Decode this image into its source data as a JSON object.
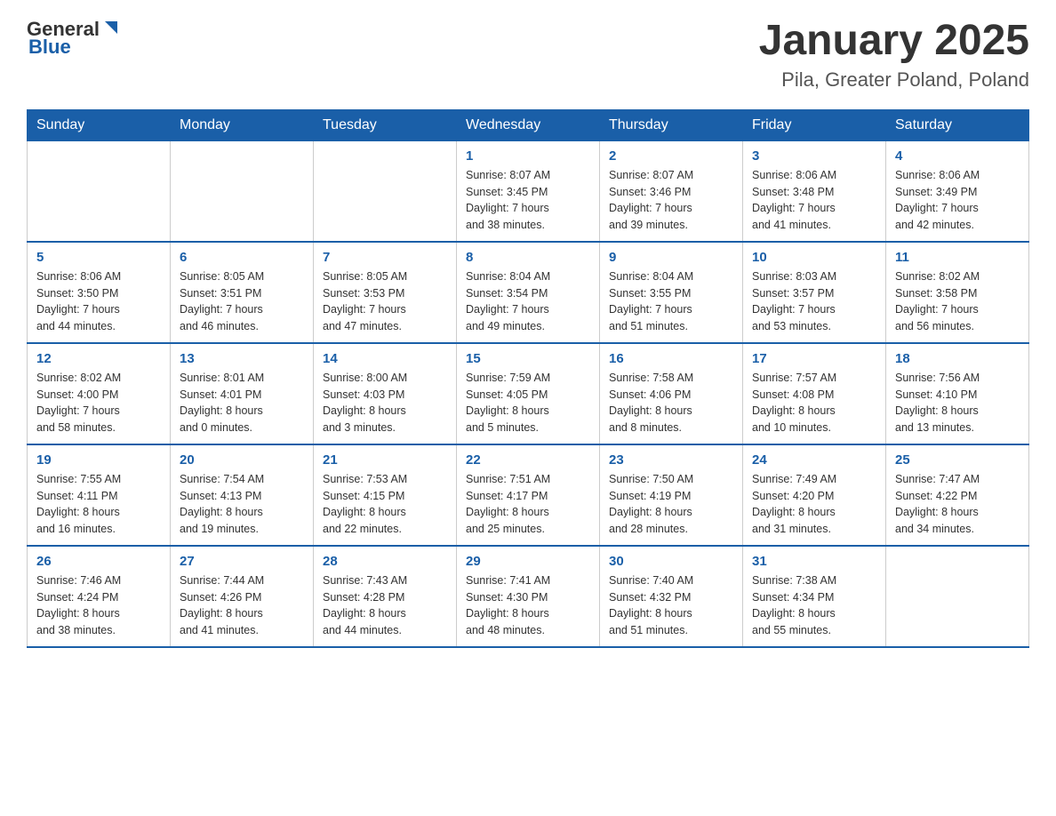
{
  "header": {
    "logo_general": "General",
    "logo_blue": "Blue",
    "title": "January 2025",
    "subtitle": "Pila, Greater Poland, Poland"
  },
  "weekdays": [
    "Sunday",
    "Monday",
    "Tuesday",
    "Wednesday",
    "Thursday",
    "Friday",
    "Saturday"
  ],
  "weeks": [
    [
      {
        "day": "",
        "info": ""
      },
      {
        "day": "",
        "info": ""
      },
      {
        "day": "",
        "info": ""
      },
      {
        "day": "1",
        "info": "Sunrise: 8:07 AM\nSunset: 3:45 PM\nDaylight: 7 hours\nand 38 minutes."
      },
      {
        "day": "2",
        "info": "Sunrise: 8:07 AM\nSunset: 3:46 PM\nDaylight: 7 hours\nand 39 minutes."
      },
      {
        "day": "3",
        "info": "Sunrise: 8:06 AM\nSunset: 3:48 PM\nDaylight: 7 hours\nand 41 minutes."
      },
      {
        "day": "4",
        "info": "Sunrise: 8:06 AM\nSunset: 3:49 PM\nDaylight: 7 hours\nand 42 minutes."
      }
    ],
    [
      {
        "day": "5",
        "info": "Sunrise: 8:06 AM\nSunset: 3:50 PM\nDaylight: 7 hours\nand 44 minutes."
      },
      {
        "day": "6",
        "info": "Sunrise: 8:05 AM\nSunset: 3:51 PM\nDaylight: 7 hours\nand 46 minutes."
      },
      {
        "day": "7",
        "info": "Sunrise: 8:05 AM\nSunset: 3:53 PM\nDaylight: 7 hours\nand 47 minutes."
      },
      {
        "day": "8",
        "info": "Sunrise: 8:04 AM\nSunset: 3:54 PM\nDaylight: 7 hours\nand 49 minutes."
      },
      {
        "day": "9",
        "info": "Sunrise: 8:04 AM\nSunset: 3:55 PM\nDaylight: 7 hours\nand 51 minutes."
      },
      {
        "day": "10",
        "info": "Sunrise: 8:03 AM\nSunset: 3:57 PM\nDaylight: 7 hours\nand 53 minutes."
      },
      {
        "day": "11",
        "info": "Sunrise: 8:02 AM\nSunset: 3:58 PM\nDaylight: 7 hours\nand 56 minutes."
      }
    ],
    [
      {
        "day": "12",
        "info": "Sunrise: 8:02 AM\nSunset: 4:00 PM\nDaylight: 7 hours\nand 58 minutes."
      },
      {
        "day": "13",
        "info": "Sunrise: 8:01 AM\nSunset: 4:01 PM\nDaylight: 8 hours\nand 0 minutes."
      },
      {
        "day": "14",
        "info": "Sunrise: 8:00 AM\nSunset: 4:03 PM\nDaylight: 8 hours\nand 3 minutes."
      },
      {
        "day": "15",
        "info": "Sunrise: 7:59 AM\nSunset: 4:05 PM\nDaylight: 8 hours\nand 5 minutes."
      },
      {
        "day": "16",
        "info": "Sunrise: 7:58 AM\nSunset: 4:06 PM\nDaylight: 8 hours\nand 8 minutes."
      },
      {
        "day": "17",
        "info": "Sunrise: 7:57 AM\nSunset: 4:08 PM\nDaylight: 8 hours\nand 10 minutes."
      },
      {
        "day": "18",
        "info": "Sunrise: 7:56 AM\nSunset: 4:10 PM\nDaylight: 8 hours\nand 13 minutes."
      }
    ],
    [
      {
        "day": "19",
        "info": "Sunrise: 7:55 AM\nSunset: 4:11 PM\nDaylight: 8 hours\nand 16 minutes."
      },
      {
        "day": "20",
        "info": "Sunrise: 7:54 AM\nSunset: 4:13 PM\nDaylight: 8 hours\nand 19 minutes."
      },
      {
        "day": "21",
        "info": "Sunrise: 7:53 AM\nSunset: 4:15 PM\nDaylight: 8 hours\nand 22 minutes."
      },
      {
        "day": "22",
        "info": "Sunrise: 7:51 AM\nSunset: 4:17 PM\nDaylight: 8 hours\nand 25 minutes."
      },
      {
        "day": "23",
        "info": "Sunrise: 7:50 AM\nSunset: 4:19 PM\nDaylight: 8 hours\nand 28 minutes."
      },
      {
        "day": "24",
        "info": "Sunrise: 7:49 AM\nSunset: 4:20 PM\nDaylight: 8 hours\nand 31 minutes."
      },
      {
        "day": "25",
        "info": "Sunrise: 7:47 AM\nSunset: 4:22 PM\nDaylight: 8 hours\nand 34 minutes."
      }
    ],
    [
      {
        "day": "26",
        "info": "Sunrise: 7:46 AM\nSunset: 4:24 PM\nDaylight: 8 hours\nand 38 minutes."
      },
      {
        "day": "27",
        "info": "Sunrise: 7:44 AM\nSunset: 4:26 PM\nDaylight: 8 hours\nand 41 minutes."
      },
      {
        "day": "28",
        "info": "Sunrise: 7:43 AM\nSunset: 4:28 PM\nDaylight: 8 hours\nand 44 minutes."
      },
      {
        "day": "29",
        "info": "Sunrise: 7:41 AM\nSunset: 4:30 PM\nDaylight: 8 hours\nand 48 minutes."
      },
      {
        "day": "30",
        "info": "Sunrise: 7:40 AM\nSunset: 4:32 PM\nDaylight: 8 hours\nand 51 minutes."
      },
      {
        "day": "31",
        "info": "Sunrise: 7:38 AM\nSunset: 4:34 PM\nDaylight: 8 hours\nand 55 minutes."
      },
      {
        "day": "",
        "info": ""
      }
    ]
  ]
}
